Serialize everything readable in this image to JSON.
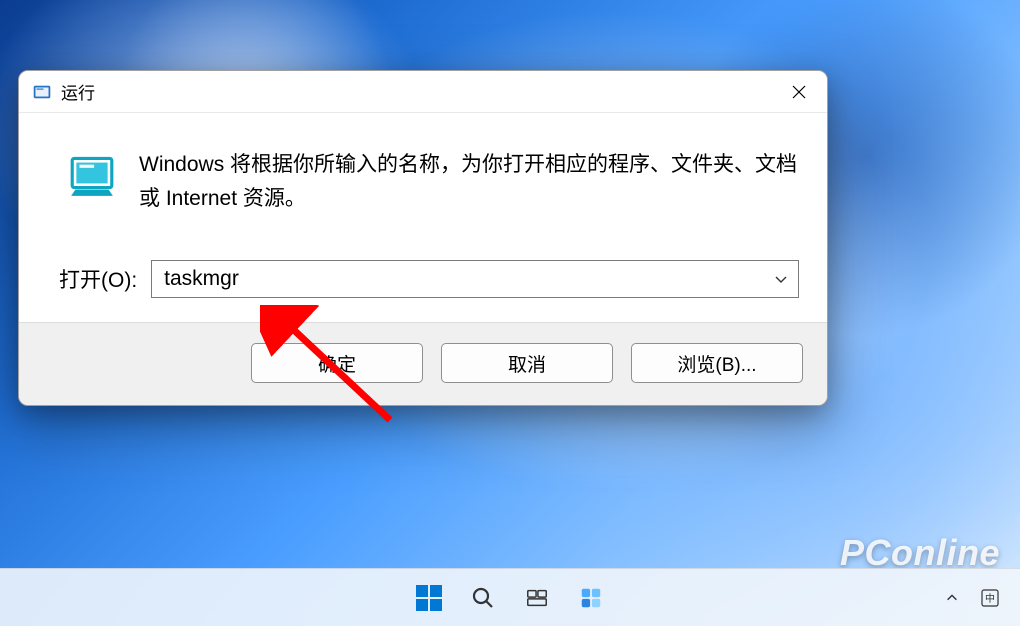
{
  "dialog": {
    "title": "运行",
    "description": "Windows 将根据你所输入的名称，为你打开相应的程序、文件夹、文档或 Internet 资源。",
    "open_label": "打开(O):",
    "input_value": "taskmgr",
    "buttons": {
      "ok": "确定",
      "cancel": "取消",
      "browse": "浏览(B)..."
    }
  },
  "watermark": "PConline"
}
